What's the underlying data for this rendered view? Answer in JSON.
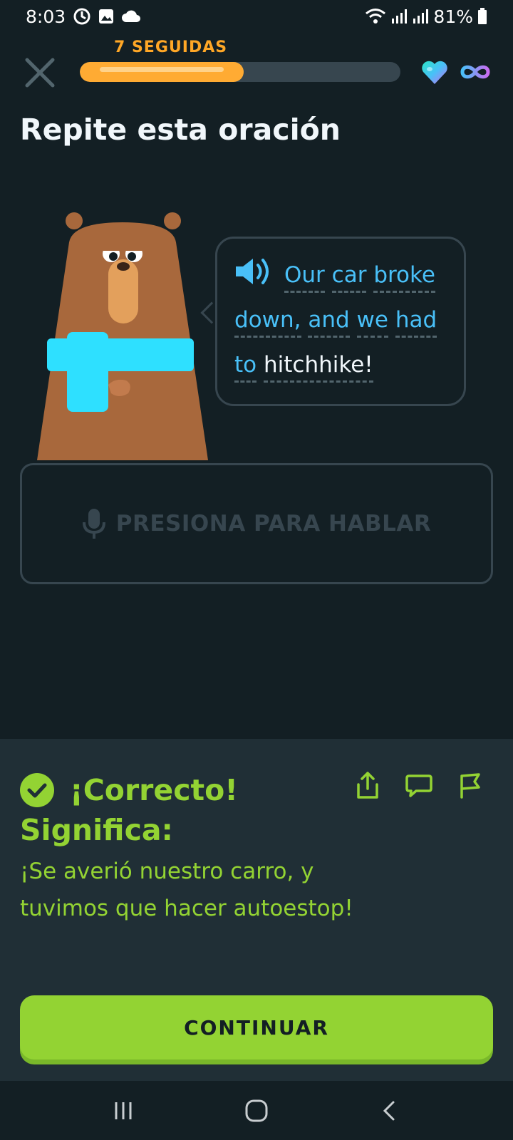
{
  "status_bar": {
    "time": "8:03",
    "battery": "81%"
  },
  "header": {
    "streak_label": "7 SEGUIDAS",
    "progress_fraction": 0.51
  },
  "page": {
    "title": "Repite esta oración"
  },
  "prompt": {
    "line1": [
      "Our",
      "car",
      "broke"
    ],
    "line2": [
      "down,",
      "and",
      "we",
      "had"
    ],
    "line3": [
      "to",
      "hitchhike!"
    ]
  },
  "speak": {
    "label": "PRESIONA PARA HABLAR"
  },
  "feedback": {
    "correct_label": "¡Correcto!",
    "meaning_label": "Significa:",
    "translation": "¡Se averió nuestro carro, y tuvimos que hacer autoestop!",
    "continue_label": "CONTINUAR"
  },
  "colors": {
    "background": "#131f24",
    "panel": "#202f36",
    "accent_green": "#93d333",
    "streak_orange": "#ffab33",
    "link_blue": "#49c0f8"
  }
}
